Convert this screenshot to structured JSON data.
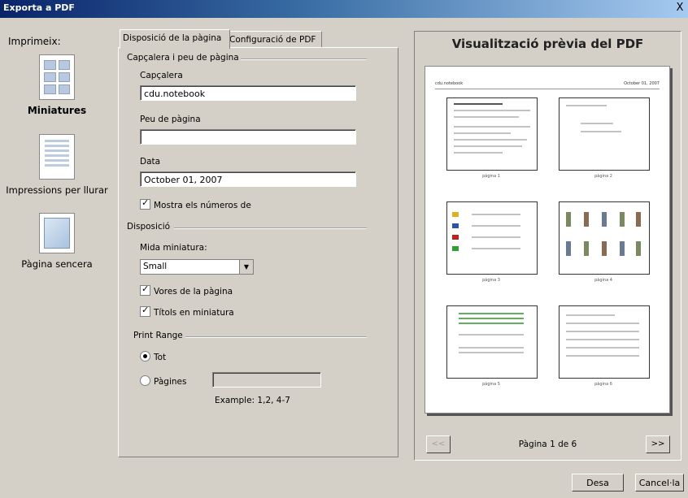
{
  "window": {
    "title": "Exporta a PDF",
    "close_label": "X"
  },
  "sidebar": {
    "title": "Imprimeix:",
    "options": [
      {
        "label": "Miniatures",
        "selected": true,
        "icon": "thumbnails-grid-icon"
      },
      {
        "label": "Impressions per llurar",
        "selected": false,
        "icon": "notes-page-icon"
      },
      {
        "label": "Pàgina sencera",
        "selected": false,
        "icon": "full-page-icon"
      }
    ]
  },
  "tabs": [
    {
      "label": "Disposició de la pàgina",
      "active": true
    },
    {
      "label": "Configuració de PDF",
      "active": false
    }
  ],
  "header_footer": {
    "group_title": "Capçalera i peu de pàgina",
    "header_label": "Capçalera",
    "header_value": "cdu.notebook",
    "footer_label": "Peu de pàgina",
    "footer_value": "",
    "date_label": "Data",
    "date_value": "October 01, 2007",
    "show_numbers_label": "Mostra els números de",
    "show_numbers_checked": true
  },
  "layout": {
    "group_title": "Disposició",
    "thumb_size_label": "Mida miniatura:",
    "thumb_size_value": "Small",
    "page_borders_label": "Vores de la pàgina",
    "page_borders_checked": true,
    "thumb_titles_label": "Títols en miniatura",
    "thumb_titles_checked": true
  },
  "print_range": {
    "group_title": "Print Range",
    "all_label": "Tot",
    "pages_label": "Pàgines",
    "selected": "all",
    "pages_value": "",
    "example": "Example:  1,2, 4-7"
  },
  "preview": {
    "title": "Visualització prèvia del PDF",
    "doc_header_left": "cdu.notebook",
    "doc_header_right": "October 01, 2007",
    "page_indicator": "Pàgina 1 de 6",
    "prev_label": "<<",
    "next_label": ">>",
    "thumb_captions": [
      "pàgina 1",
      "pàgina 2",
      "pàgina 3",
      "pàgina 4",
      "pàgina 5",
      "pàgina 6"
    ]
  },
  "buttons": {
    "save": "Desa",
    "cancel": "Cancel·la"
  },
  "colors": {
    "dialog_bg": "#d4d0c8",
    "titlebar_start": "#0a246a",
    "titlebar_end": "#a6caf0"
  }
}
